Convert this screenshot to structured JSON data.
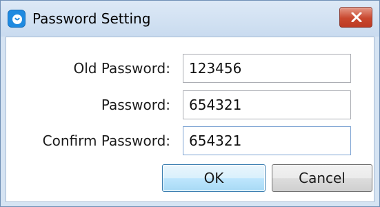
{
  "window": {
    "title": "Password Setting",
    "app_icon": "app-logo-icon",
    "close_icon": "close-icon",
    "colors": {
      "titlebar": "#c9dbef",
      "close_button": "#c9482f",
      "app_icon": "#1e8ae0"
    }
  },
  "form": {
    "old_password": {
      "label": "Old Password:",
      "value": "123456"
    },
    "password": {
      "label": "Password:",
      "value": "654321"
    },
    "confirm_password": {
      "label": "Confirm Password:",
      "value": "654321"
    }
  },
  "buttons": {
    "ok_label": "OK",
    "cancel_label": "Cancel"
  }
}
